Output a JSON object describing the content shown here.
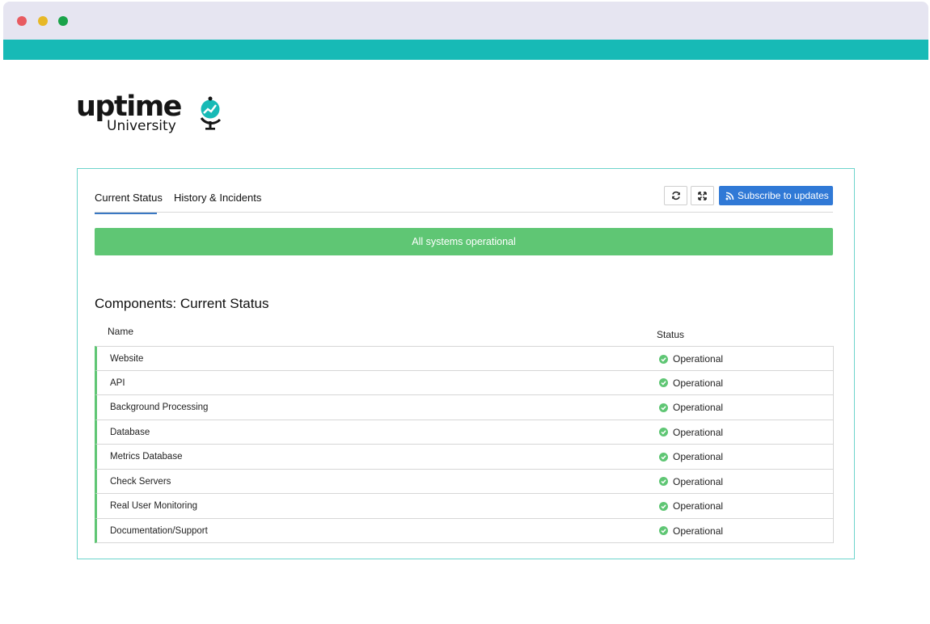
{
  "colors": {
    "titlebar": "#e6e5f1",
    "accent_teal": "#17bab6",
    "panel_border": "#6dd4cc",
    "operational_green": "#5fc674",
    "subscribe_blue": "#3079d6",
    "tab_underline": "#3a78c3"
  },
  "logo": {
    "word": "uptime",
    "sub": "University"
  },
  "tabs": [
    {
      "label": "Current Status",
      "active": true
    },
    {
      "label": "History & Incidents",
      "active": false
    }
  ],
  "toolbar": {
    "refresh_icon": "refresh-icon",
    "expand_icon": "expand-icon",
    "subscribe_label": "Subscribe to updates",
    "rss_icon": "rss-icon"
  },
  "banner": {
    "text": "All systems operational"
  },
  "components": {
    "title": "Components: Current Status",
    "columns": {
      "name": "Name",
      "status": "Status"
    },
    "rows": [
      {
        "name": "Website",
        "status": "Operational"
      },
      {
        "name": "API",
        "status": "Operational"
      },
      {
        "name": "Background Processing",
        "status": "Operational"
      },
      {
        "name": "Database",
        "status": "Operational"
      },
      {
        "name": "Metrics Database",
        "status": "Operational"
      },
      {
        "name": "Check Servers",
        "status": "Operational"
      },
      {
        "name": "Real User Monitoring",
        "status": "Operational"
      },
      {
        "name": "Documentation/Support",
        "status": "Operational"
      }
    ]
  }
}
